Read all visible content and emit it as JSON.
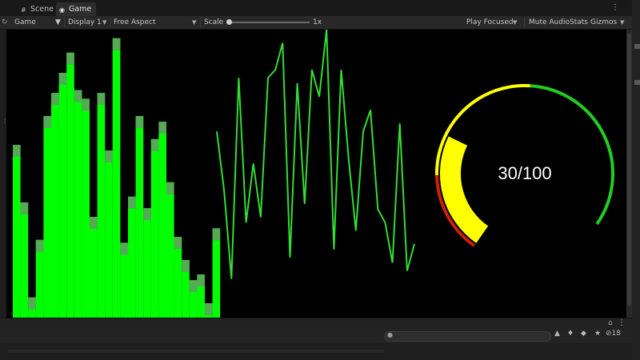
{
  "tabs": [
    {
      "label": "Scene",
      "icon": "hash-icon"
    },
    {
      "label": "Game",
      "icon": "gamepad-icon"
    }
  ],
  "toolbar": {
    "display_mode": "Game",
    "display": "Display 1",
    "aspect": "Free Aspect",
    "scale_label": "Scale",
    "scale_value": "1x",
    "play_mode": "Play Focused",
    "mute": "Mute Audio",
    "stats": "Stats",
    "gizmos": "Gizmos"
  },
  "colors": {
    "bar_green": "#00ff00",
    "bar_top_shade": "#55aa55",
    "line_green": "#33dd33",
    "gauge_yellow": "#ffff00",
    "gauge_red": "#cc2200",
    "gauge_green": "#22cc22"
  },
  "chart_data": [
    {
      "type": "bar",
      "values": [
        60,
        40,
        7,
        27,
        70,
        78,
        85,
        92,
        79,
        76,
        35,
        78,
        58,
        97,
        26,
        42,
        70,
        38,
        62,
        68,
        47,
        28,
        20,
        13,
        15,
        5,
        31
      ]
    },
    {
      "type": "line",
      "values": [
        62,
        40,
        7,
        82,
        28,
        50,
        30,
        82,
        85,
        95,
        15,
        80,
        35,
        85,
        75,
        100,
        18,
        85,
        52,
        25,
        62,
        70,
        33,
        28,
        13,
        65,
        10,
        20
      ]
    },
    {
      "type": "gauge",
      "value": 30,
      "max": 100,
      "label": "30/100"
    }
  ],
  "console": {
    "search_placeholder": "",
    "count": "18"
  }
}
